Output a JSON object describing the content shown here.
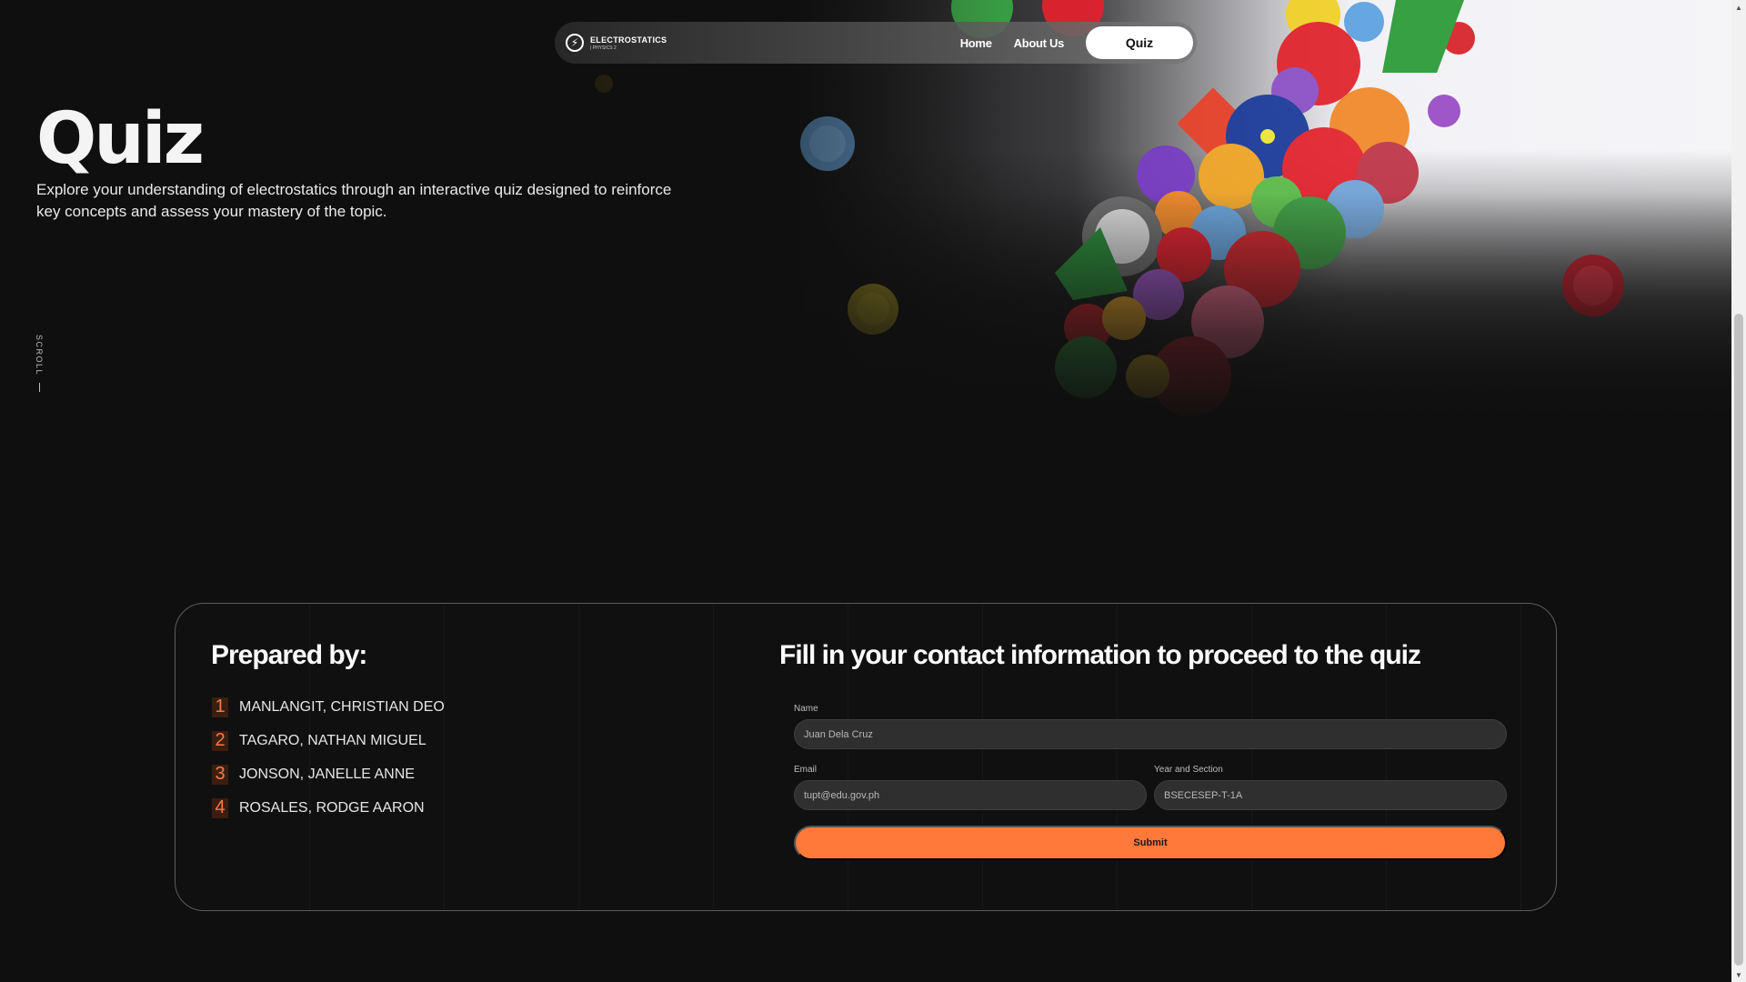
{
  "nav": {
    "brand_title": "ELECTROSTATICS",
    "brand_subtitle": "| PHYSICS 2",
    "links": [
      "Home",
      "About Us"
    ],
    "cta_label": "Quiz"
  },
  "hero": {
    "title": "Quiz",
    "description": "Explore your understanding of electrostatics through an interactive quiz designed to reinforce key concepts and assess your mastery of the topic.",
    "scroll_label": "SCROLL"
  },
  "prepared": {
    "title": "Prepared by:",
    "members": [
      {
        "num": "1",
        "name": "MANLANGIT, CHRISTIAN DEO"
      },
      {
        "num": "2",
        "name": "TAGARO, NATHAN MIGUEL"
      },
      {
        "num": "3",
        "name": "JONSON, JANELLE ANNE"
      },
      {
        "num": "4",
        "name": "ROSALES, RODGE AARON"
      }
    ]
  },
  "form": {
    "title": "Fill in your contact information to proceed to the quiz",
    "name_label": "Name",
    "name_placeholder": "Juan Dela Cruz",
    "email_label": "Email",
    "email_placeholder": "tupt@edu.gov.ph",
    "section_label": "Year and Section",
    "section_placeholder": "BSECESEP-T-1A",
    "submit_label": "Submit"
  },
  "colors": {
    "accent": "#ff7a3a",
    "background": "#0f0f0f",
    "card_border": "#5c5c5c"
  },
  "icons": {
    "brand": "lightning-bolt-icon",
    "scroll_up": "arrow-up-icon",
    "scroll_down": "arrow-down-icon"
  }
}
